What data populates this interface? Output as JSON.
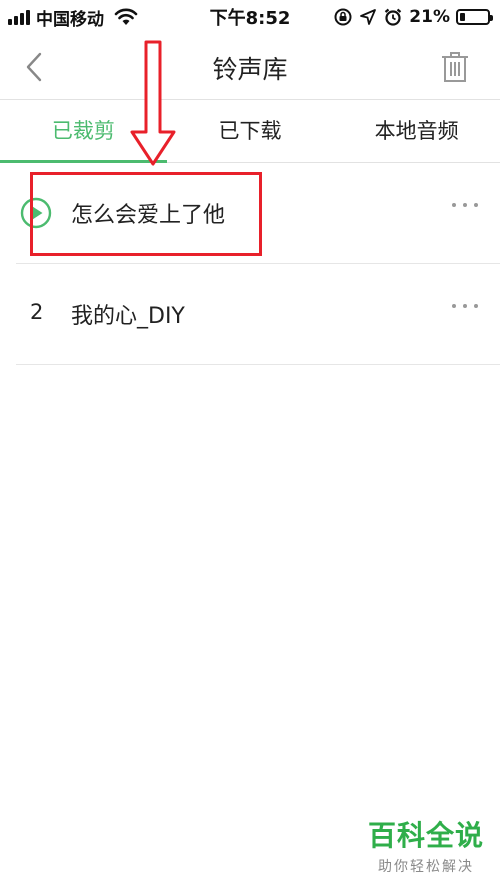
{
  "status_bar": {
    "carrier": "中国移动",
    "time": "下午8:52",
    "battery_percent": "21%",
    "battery_level": 0.21,
    "icons": [
      "signal-icon",
      "wifi-icon",
      "rotation-lock-icon",
      "location-icon",
      "alarm-icon",
      "battery-icon"
    ]
  },
  "nav": {
    "title": "铃声库",
    "back_icon": "chevron-left-icon",
    "delete_icon": "trash-icon"
  },
  "tabs": [
    {
      "label": "已裁剪",
      "active": true
    },
    {
      "label": "已下载",
      "active": false
    },
    {
      "label": "本地音频",
      "active": false
    }
  ],
  "songs": [
    {
      "index": "",
      "playing": true,
      "title": "怎么会爱上了他"
    },
    {
      "index": "2",
      "playing": false,
      "title": "我的心_DIY"
    }
  ],
  "watermark": {
    "title": "百科全说",
    "subtitle": "助你轻松解决"
  },
  "colors": {
    "accent": "#4cbb6f",
    "annotation": "#e8202a",
    "watermark": "#2fae4a"
  }
}
